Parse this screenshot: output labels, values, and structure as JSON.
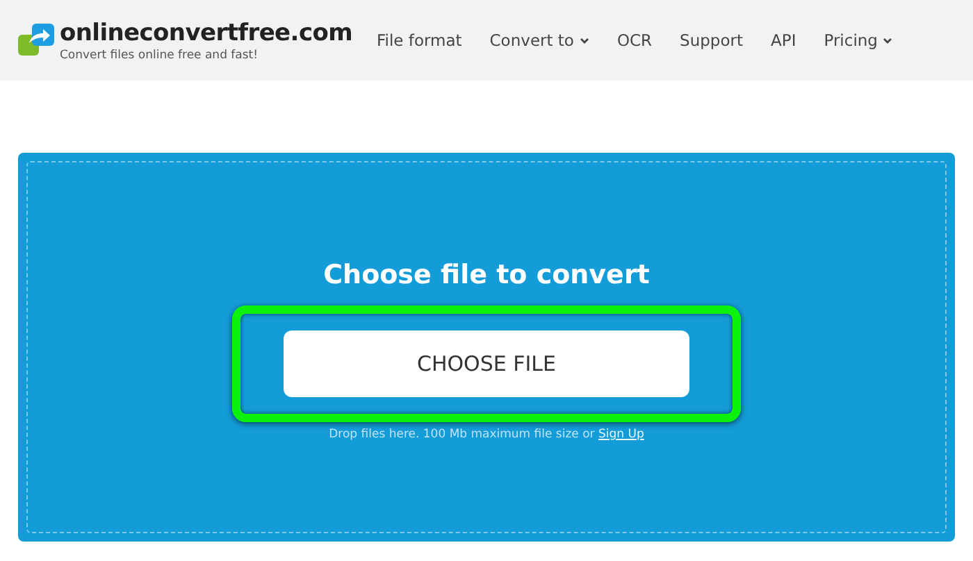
{
  "header": {
    "logo": "onlineconvertfree.com",
    "tagline": "Convert files online free and fast!",
    "nav": [
      {
        "label": "File format",
        "has_menu": false
      },
      {
        "label": "Convert to",
        "has_menu": true
      },
      {
        "label": "OCR",
        "has_menu": false
      },
      {
        "label": "Support",
        "has_menu": false
      },
      {
        "label": "API",
        "has_menu": false
      },
      {
        "label": "Pricing",
        "has_menu": true
      }
    ]
  },
  "upload": {
    "title": "Choose file to convert",
    "button": "CHOOSE FILE",
    "highlighted": true,
    "hint": "Drop files here. 100 Mb maximum file size or",
    "link": "Sign Up"
  }
}
